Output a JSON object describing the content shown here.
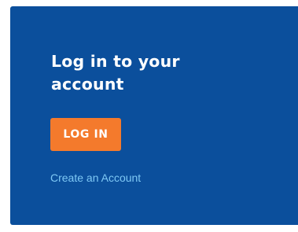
{
  "login_card": {
    "heading": "Log in to your account",
    "login_button_label": "LOG IN",
    "create_account_link": "Create an Account"
  },
  "colors": {
    "card_background": "#0b4f9c",
    "button_background": "#f47a2c",
    "link_color": "#7ec8f5",
    "text_color": "#ffffff"
  }
}
